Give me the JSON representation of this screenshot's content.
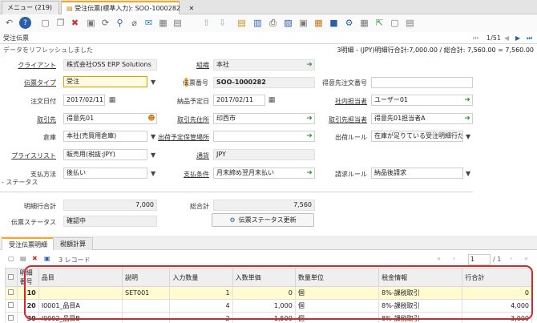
{
  "tabs": [
    {
      "label": "メニュー (219)"
    },
    {
      "label": "受注伝票(標準入力): SOO-1000282",
      "close": "✕"
    }
  ],
  "window_title": "受注伝票",
  "status_message": "データをリフレッシュしました",
  "summary": "3明細 - (JPY)明細行合計:7,000.00 / 総合計: 7,560.00 = 7,560.00",
  "record_nav": {
    "count": "1/51"
  },
  "form": {
    "client": {
      "label": "クライアント",
      "value": "株式会社OSS ERP Solutions"
    },
    "org": {
      "label": "組織",
      "value": "本社"
    },
    "doc_type": {
      "label": "伝票タイプ",
      "value": "受注"
    },
    "doc_no": {
      "label": "伝票番号",
      "value": "SOO-1000282"
    },
    "customer_order_no": {
      "label": "得意先注文番号",
      "value": ""
    },
    "order_date": {
      "label": "注文日付",
      "value": "2017/02/11"
    },
    "delivery_date": {
      "label": "納品予定日",
      "value": "2017/02/11"
    },
    "sales_rep": {
      "label": "社内担当者",
      "value": "ユーザー01"
    },
    "bpartner": {
      "label": "取引先",
      "value": "得意先01"
    },
    "bp_address": {
      "label": "取引先住所",
      "value": "印西市"
    },
    "bp_contact": {
      "label": "取引先担当者",
      "value": "得意先01担当者A"
    },
    "warehouse": {
      "label": "倉庫",
      "value": "本社(売買用倉庫)"
    },
    "ship_location": {
      "label": "出荷予定保管場所",
      "value": ""
    },
    "delivery_rule": {
      "label": "出荷ルール",
      "value": "在庫が足りている受注明細行だ"
    },
    "price_list": {
      "label": "プライスリスト",
      "value": "販売用(税抜:JPY)"
    },
    "currency": {
      "label": "通貨",
      "value": "JPY"
    },
    "payment_rule": {
      "label": "支払方法",
      "value": "後払い"
    },
    "payment_term": {
      "label": "支払条件",
      "value": "月末締め翌月末払い"
    },
    "invoice_rule": {
      "label": "請求ルール",
      "value": "納品後請求"
    },
    "status_section": "- ステータス",
    "line_total": {
      "label": "明細行合計",
      "value": "7,000"
    },
    "grand_total": {
      "label": "総合計",
      "value": "7,560"
    },
    "doc_status": {
      "label": "伝票ステータス",
      "value": "確認中"
    },
    "status_button": "伝票ステータス更新"
  },
  "detail_tabs": [
    {
      "label": "受注伝票明細"
    },
    {
      "label": "税額計算"
    }
  ],
  "grid_toolbar": {
    "record_count": "3 レコード",
    "page_input": "1",
    "page_total": "/ 1"
  },
  "grid": {
    "columns": [
      "明細番号",
      "品目",
      "説明",
      "入力数量",
      "入数単価",
      "数量単位",
      "税金情報",
      "行合計"
    ],
    "rows": [
      [
        "10",
        "",
        "SET001",
        "1",
        "0",
        "個",
        "8%-課税取引",
        "0"
      ],
      [
        "20",
        "I0001_品目A",
        "",
        "4",
        "1,000",
        "個",
        "8%-課税取引",
        "4,000"
      ],
      [
        "30",
        "I0002_品目B",
        "",
        "2",
        "1,500",
        "個",
        "8%-課税取引",
        "3,000"
      ]
    ]
  },
  "colors": {
    "accent": "#f5a623",
    "highlight_ring": "#d8242b",
    "required_bg": "#fffbe0"
  }
}
